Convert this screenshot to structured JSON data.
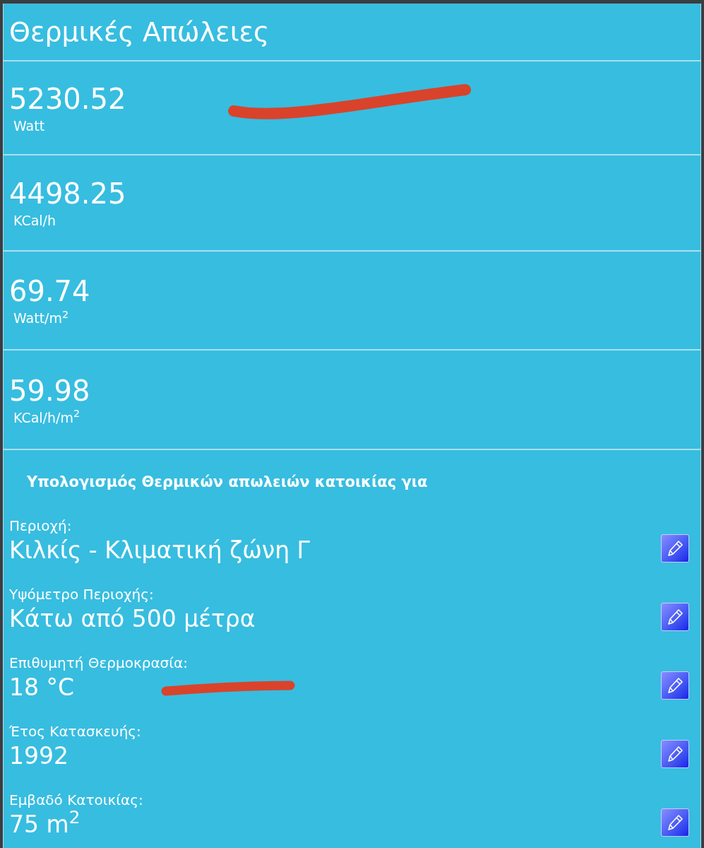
{
  "title": "Θερμικές Απώλειες",
  "results": [
    {
      "value": "5230.52",
      "unit": "Watt"
    },
    {
      "value": "4498.25",
      "unit": "KCal/h"
    },
    {
      "value": "69.74",
      "unit": "Watt/m$^{2}$"
    },
    {
      "value": "59.98",
      "unit": "KCal/h/m$^{2}$"
    }
  ],
  "inputs": {
    "heading": "Υπολογισμός Θερμικών απωλειών κατοικίας για",
    "fields": [
      {
        "label": "Περιοχή:",
        "value": "Κιλκίς - Κλιματική ζώνη Γ"
      },
      {
        "label": "Υψόμετρο Περιοχής:",
        "value": "Κάτω από 500 μέτρα"
      },
      {
        "label": "Επιθυμητή Θερμοκρασία:",
        "value": "18 °C"
      },
      {
        "label": "Έτος Κατασκευής:",
        "value": "1992"
      },
      {
        "label": "Εμβαδό Κατοικίας:",
        "value": "75 m$^{2}$"
      }
    ]
  }
}
